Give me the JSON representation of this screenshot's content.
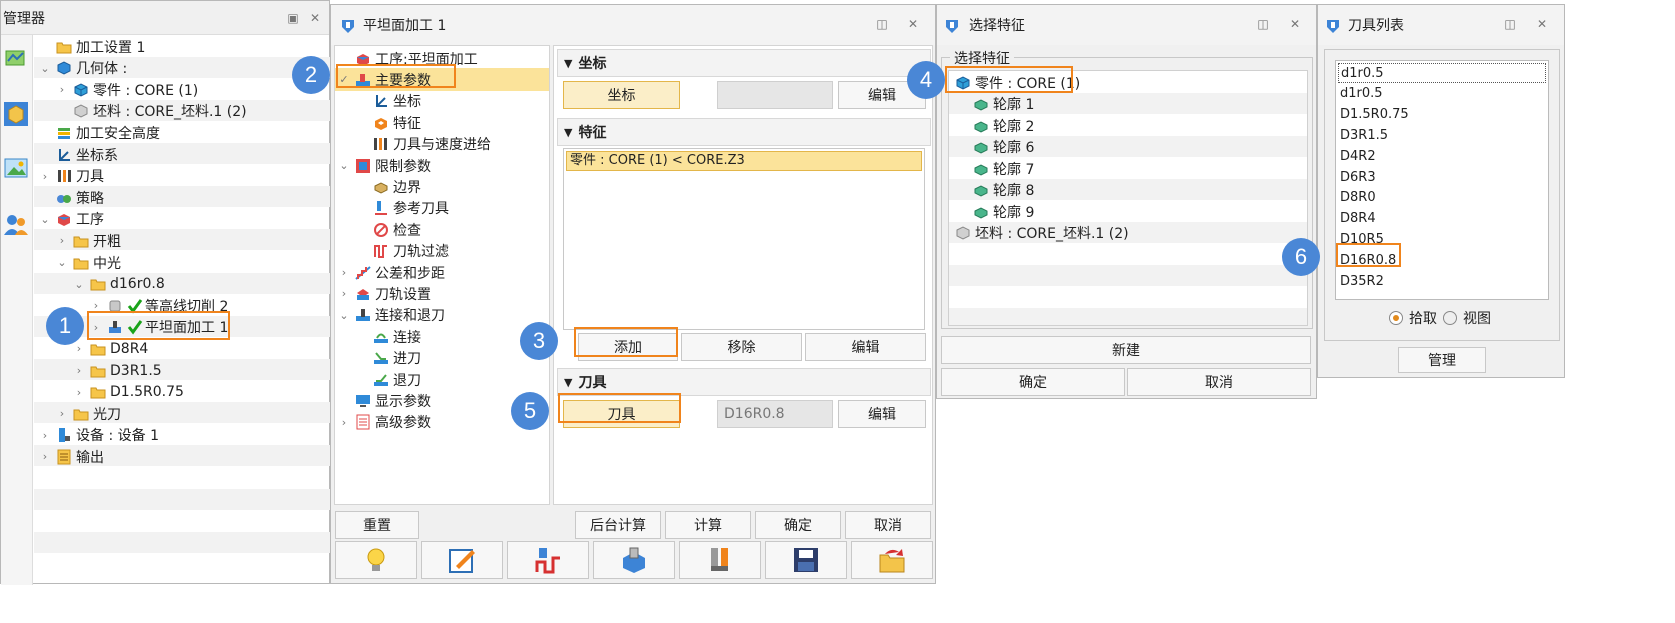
{
  "manager": {
    "title": "管理器",
    "tree": [
      {
        "label": "加工设置 1",
        "icon": "folder-icon",
        "level": 0,
        "exp": ""
      },
      {
        "label": "几何体 :",
        "icon": "geometry-icon",
        "level": 0,
        "exp": "v"
      },
      {
        "label": "零件 : CORE (1)",
        "icon": "part-icon",
        "level": 1,
        "exp": ">"
      },
      {
        "label": "坯料 : CORE_坯料.1 (2)",
        "icon": "stock-icon",
        "level": 1,
        "exp": ""
      },
      {
        "label": "加工安全高度",
        "icon": "safe-height-icon",
        "level": 0,
        "exp": ""
      },
      {
        "label": "坐标系",
        "icon": "coordinate-icon",
        "level": 0,
        "exp": ""
      },
      {
        "label": "刀具",
        "icon": "tool-icon",
        "level": 0,
        "exp": ">"
      },
      {
        "label": "策略",
        "icon": "strategy-icon",
        "level": 0,
        "exp": ""
      },
      {
        "label": "工序",
        "icon": "operation-icon",
        "level": 0,
        "exp": "v"
      },
      {
        "label": "开粗",
        "icon": "folder-icon",
        "level": 1,
        "exp": ">"
      },
      {
        "label": "中光",
        "icon": "folder-icon",
        "level": 1,
        "exp": "v"
      },
      {
        "label": "d16r0.8",
        "icon": "folder-icon",
        "level": 2,
        "exp": "v"
      },
      {
        "label": "等高线切削 2",
        "icon": "contour-op-icon",
        "level": 3,
        "exp": ">",
        "check": true
      },
      {
        "label": "平坦面加工 1",
        "icon": "flat-op-icon",
        "level": 3,
        "exp": ">",
        "check": true
      },
      {
        "label": "D8R4",
        "icon": "folder-icon",
        "level": 2,
        "exp": ">"
      },
      {
        "label": "D3R1.5",
        "icon": "folder-icon",
        "level": 2,
        "exp": ">"
      },
      {
        "label": "D1.5R0.75",
        "icon": "folder-icon",
        "level": 2,
        "exp": ">"
      },
      {
        "label": "光刀",
        "icon": "folder-icon",
        "level": 1,
        "exp": ">"
      },
      {
        "label": "设备 : 设备 1",
        "icon": "machine-icon",
        "level": 0,
        "exp": ">"
      },
      {
        "label": "输出",
        "icon": "output-icon",
        "level": 0,
        "exp": ">"
      }
    ]
  },
  "flat_dialog": {
    "title": "平坦面加工 1",
    "nav": [
      {
        "label": "工序:平坦面加工",
        "icon": "operation-icon",
        "level": 0,
        "exp": ""
      },
      {
        "label": "主要参数",
        "icon": "main-params-icon",
        "level": 0,
        "exp": "v"
      },
      {
        "label": "坐标",
        "icon": "coordinate-icon",
        "level": 1,
        "exp": ""
      },
      {
        "label": "特征",
        "icon": "feature-icon",
        "level": 1,
        "exp": ""
      },
      {
        "label": "刀具与速度进给",
        "icon": "tool-speed-icon",
        "level": 1,
        "exp": ""
      },
      {
        "label": "限制参数",
        "icon": "limit-params-icon",
        "level": 0,
        "exp": "v"
      },
      {
        "label": "边界",
        "icon": "boundary-icon",
        "level": 1,
        "exp": ""
      },
      {
        "label": "参考刀具",
        "icon": "reference-tool-icon",
        "level": 1,
        "exp": ""
      },
      {
        "label": "检查",
        "icon": "check-icon",
        "level": 1,
        "exp": ""
      },
      {
        "label": "刀轨过滤",
        "icon": "toolpath-filter-icon",
        "level": 1,
        "exp": ""
      },
      {
        "label": "公差和步距",
        "icon": "tolerance-icon",
        "level": 0,
        "exp": ">"
      },
      {
        "label": "刀轨设置",
        "icon": "toolpath-settings-icon",
        "level": 0,
        "exp": ">"
      },
      {
        "label": "连接和退刀",
        "icon": "link-retract-icon",
        "level": 0,
        "exp": "v"
      },
      {
        "label": "连接",
        "icon": "link-icon",
        "level": 1,
        "exp": ""
      },
      {
        "label": "进刀",
        "icon": "lead-in-icon",
        "level": 1,
        "exp": ""
      },
      {
        "label": "退刀",
        "icon": "lead-out-icon",
        "level": 1,
        "exp": ""
      },
      {
        "label": "显示参数",
        "icon": "display-params-icon",
        "level": 0,
        "exp": ""
      },
      {
        "label": "高级参数",
        "icon": "advanced-params-icon",
        "level": 0,
        "exp": ">"
      }
    ],
    "coord": {
      "header": "坐标",
      "button": "坐标",
      "edit": "编辑"
    },
    "feature": {
      "header": "特征",
      "item": "零件 : CORE (1) < CORE.Z3",
      "add": "添加",
      "remove": "移除",
      "edit": "编辑"
    },
    "tool": {
      "header": "刀具",
      "button": "刀具",
      "value": "D16R0.8",
      "edit": "编辑"
    },
    "footer": {
      "reset": "重置",
      "bg_calc": "后台计算",
      "calc": "计算",
      "ok": "确定",
      "cancel": "取消"
    }
  },
  "select_feature": {
    "title": "选择特征",
    "group": "选择特征",
    "items": [
      {
        "label": "零件 : CORE (1)",
        "icon": "part-icon",
        "level": 0
      },
      {
        "label": "轮廓 1",
        "icon": "contour-icon",
        "level": 1
      },
      {
        "label": "轮廓 2",
        "icon": "contour-icon",
        "level": 1
      },
      {
        "label": "轮廓 6",
        "icon": "contour-icon",
        "level": 1
      },
      {
        "label": "轮廓 7",
        "icon": "contour-icon",
        "level": 1
      },
      {
        "label": "轮廓 8",
        "icon": "contour-icon",
        "level": 1
      },
      {
        "label": "轮廓 9",
        "icon": "contour-icon",
        "level": 1
      },
      {
        "label": "坯料 : CORE_坯料.1 (2)",
        "icon": "stock-icon",
        "level": 0
      }
    ],
    "new": "新建",
    "ok": "确定",
    "cancel": "取消"
  },
  "tool_list": {
    "title": "刀具列表",
    "items": [
      "d1r0.5",
      "d1r0.5",
      "D1.5R0.75",
      "D3R1.5",
      "D4R2",
      "D6R3",
      "D8R0",
      "D8R4",
      "D10R5",
      "D16R0.8",
      "D35R2"
    ],
    "pick": "拾取",
    "view": "视图",
    "manage": "管理"
  },
  "badges": [
    "1",
    "2",
    "3",
    "4",
    "5",
    "6"
  ],
  "colors": {
    "accent_box": "#f0841c",
    "badge": "#4a87d6",
    "selected": "#fbe39a",
    "check": "#1aa31a"
  }
}
